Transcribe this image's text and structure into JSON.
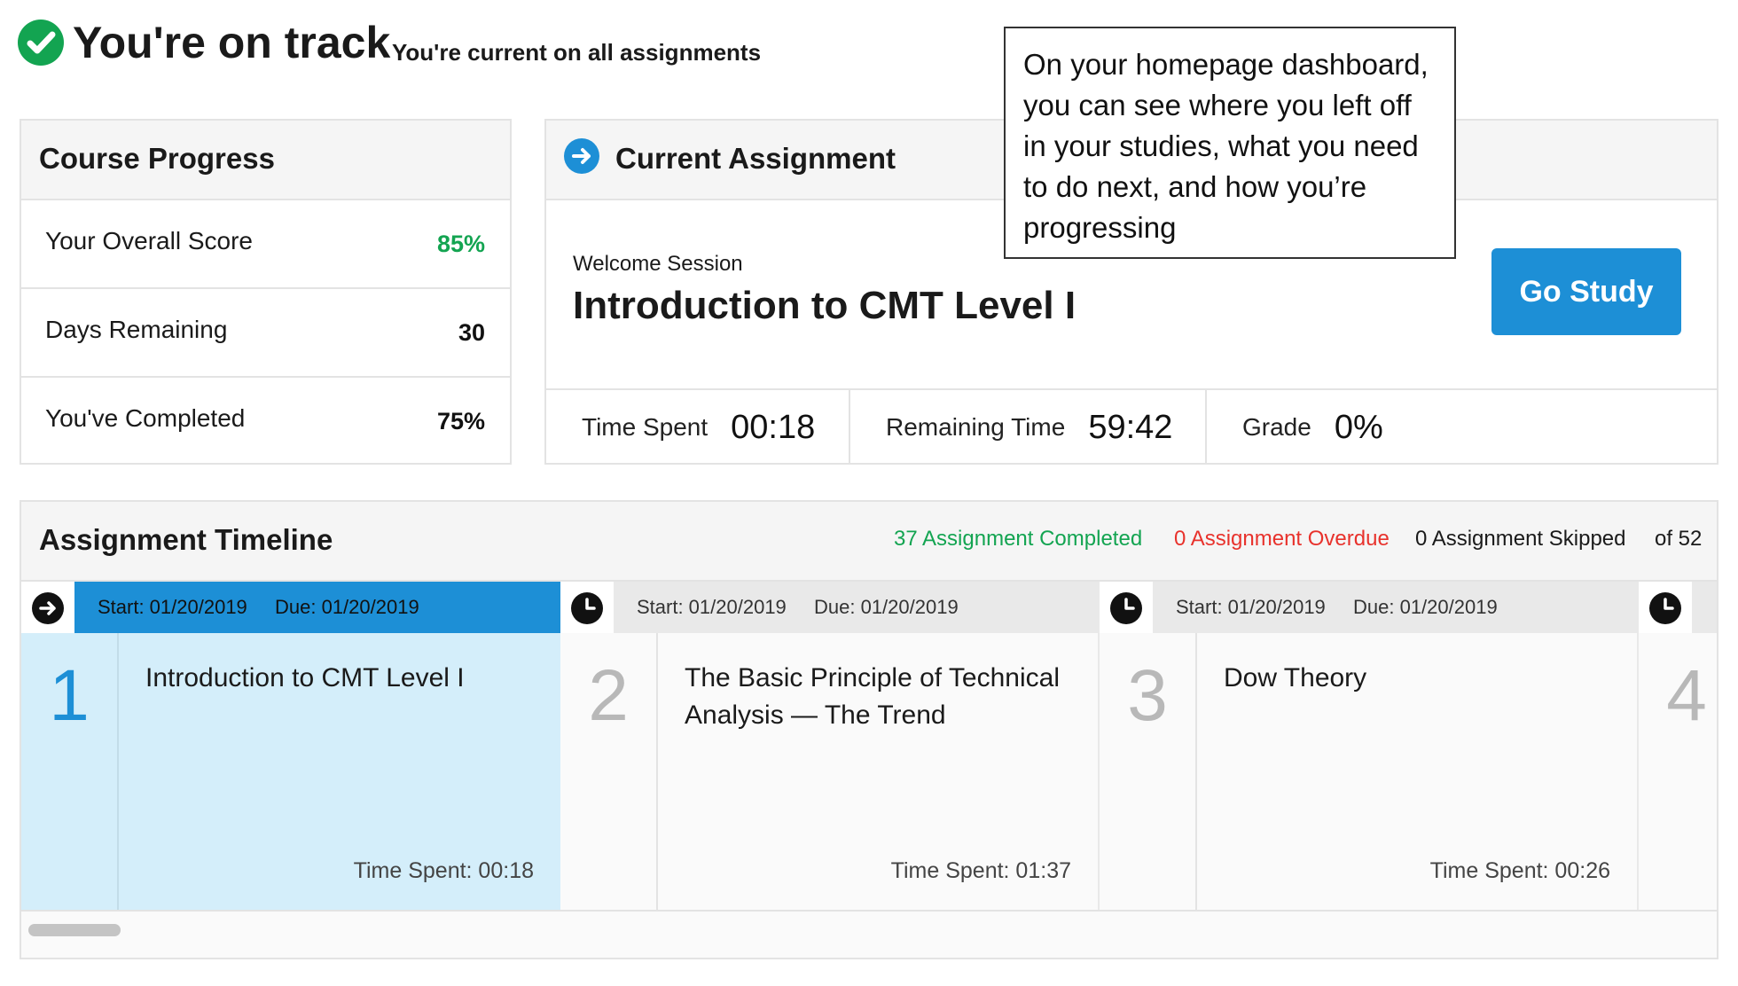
{
  "status": {
    "title": "You're on track",
    "subtitle": "You're current on all assignments",
    "icon": "check-circle-icon",
    "color": "#13a451"
  },
  "tooltip": {
    "text": "On your homepage dashboard, you can see where you left off in your studies, what you need to do next, and how you’re progressing"
  },
  "course_progress": {
    "title": "Course Progress",
    "rows": [
      {
        "label": "Your Overall Score",
        "value": "85%",
        "color": "#13a451"
      },
      {
        "label": "Days Remaining",
        "value": "30",
        "color": "#111111"
      },
      {
        "label": "You've Completed",
        "value": "75%",
        "color": "#111111"
      }
    ]
  },
  "current_assignment": {
    "title": "Current Assignment",
    "icon": "arrow-right-circle-icon",
    "session_label": "Welcome Session",
    "name": "Introduction to CMT Level I",
    "button_label": "Go Study",
    "stats": [
      {
        "label": "Time Spent",
        "value": "00:18"
      },
      {
        "label": "Remaining Time",
        "value": "59:42"
      },
      {
        "label": "Grade",
        "value": "0%"
      }
    ]
  },
  "timeline": {
    "title": "Assignment Timeline",
    "completed": "37 Assignment Completed",
    "overdue": "0 Assignment Overdue",
    "skipped": "0 Assignment Skipped",
    "total": "of 52",
    "cards": [
      {
        "number": "1",
        "icon": "arrow-right-circle-icon",
        "start": "Start: 01/20/2019",
        "due": "Due: 01/20/2019",
        "title": "Introduction to CMT Level I",
        "time_spent": "Time Spent: 00:18",
        "active": true
      },
      {
        "number": "2",
        "icon": "clock-icon",
        "start": "Start: 01/20/2019",
        "due": "Due: 01/20/2019",
        "title": "The Basic Principle of Technical Analysis — The Trend",
        "time_spent": "Time Spent: 01:37",
        "active": false
      },
      {
        "number": "3",
        "icon": "clock-icon",
        "start": "Start: 01/20/2019",
        "due": "Due: 01/20/2019",
        "title": "Dow Theory",
        "time_spent": "Time Spent: 00:26",
        "active": false
      },
      {
        "number": "4",
        "icon": "clock-icon",
        "active": false
      }
    ]
  },
  "colors": {
    "accent": "#1d8fd6",
    "success": "#13a451",
    "danger": "#e8322c",
    "active_card": "#d4eefa"
  }
}
